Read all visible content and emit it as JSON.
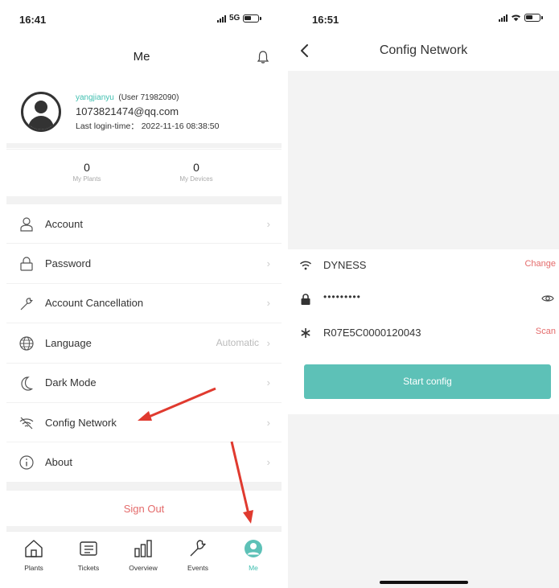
{
  "left_screen": {
    "status": {
      "time": "16:41",
      "network": "5G"
    },
    "title": "Me",
    "profile": {
      "username": "yangjianyu",
      "user_tag": "(User 71982090)",
      "email": "1073821474@qq.com",
      "last_login": "Last login-time： 2022-11-16 08:38:50"
    },
    "stats": [
      {
        "value": "0",
        "label": "My Plants"
      },
      {
        "value": "0",
        "label": "My Devices"
      }
    ],
    "menu": [
      {
        "label": "Account",
        "value": "",
        "icon": "user-icon"
      },
      {
        "label": "Password",
        "value": "",
        "icon": "lock-icon"
      },
      {
        "label": "Account Cancellation",
        "value": "",
        "icon": "wrench-icon"
      },
      {
        "label": "Language",
        "value": "Automatic",
        "icon": "globe-icon"
      },
      {
        "label": "Dark Mode",
        "value": "",
        "icon": "moon-icon"
      },
      {
        "label": "Config Network",
        "value": "",
        "icon": "wifi-icon"
      },
      {
        "label": "About",
        "value": "",
        "icon": "info-icon"
      }
    ],
    "sign_out": "Sign Out",
    "tabs": [
      {
        "label": "Plants",
        "icon": "home-icon"
      },
      {
        "label": "Tickets",
        "icon": "ticket-icon"
      },
      {
        "label": "Overview",
        "icon": "bar-chart-icon"
      },
      {
        "label": "Events",
        "icon": "wrench-icon"
      },
      {
        "label": "Me",
        "icon": "person-icon",
        "active": true
      }
    ]
  },
  "right_screen": {
    "status": {
      "time": "16:51"
    },
    "title": "Config Network",
    "wifi_name": "DYNESS",
    "change_label": "Change",
    "password_mask": "•••••••••",
    "serial": "R07E5C0000120043",
    "scan_label": "Scan",
    "start_button": "Start config"
  },
  "colors": {
    "accent": "#3fbfb0",
    "button": "#5dc1b7",
    "danger": "#e46b6b",
    "arrow": "#e03a2f"
  }
}
